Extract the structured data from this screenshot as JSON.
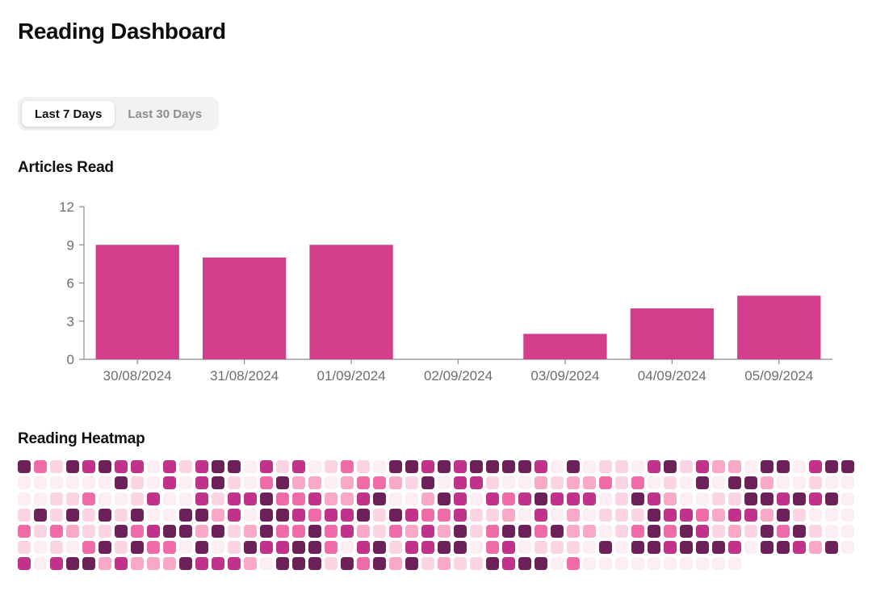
{
  "header": {
    "title": "Reading Dashboard"
  },
  "range_selector": {
    "name": "time-range-segmented-control",
    "options": [
      {
        "label": "Last 7 Days",
        "active": true
      },
      {
        "label": "Last 30 Days",
        "active": false
      }
    ]
  },
  "sections": {
    "articles_read_title": "Articles Read",
    "heatmap_title": "Reading Heatmap"
  },
  "colors": {
    "bar": "#d43d8c",
    "axis": "#8a8a8a",
    "tick_text": "#6d6d72",
    "title": "#0d0d0d",
    "segment_track": "#f2f2f2",
    "segment_active_bg": "#ffffff",
    "segment_inactive_text": "#8e8e93",
    "heat_level_0": "#fdeef4",
    "heat_level_1": "#fbd5e4",
    "heat_level_2": "#f9a8c8",
    "heat_level_3": "#f06ca8",
    "heat_level_4": "#c0318a",
    "heat_level_5": "#6b2057"
  },
  "chart_data": {
    "type": "bar",
    "title": "Articles Read",
    "xlabel": "",
    "ylabel": "",
    "categories": [
      "30/08/2024",
      "31/08/2024",
      "01/09/2024",
      "02/09/2024",
      "03/09/2024",
      "04/09/2024",
      "05/09/2024"
    ],
    "values": [
      9,
      8,
      9,
      0,
      2,
      4,
      5
    ],
    "ylim": [
      0,
      12
    ],
    "yticks": [
      0,
      3,
      6,
      9,
      12
    ],
    "ytick_labels": [
      "0",
      "3",
      "6",
      "9",
      "12"
    ],
    "grid": false,
    "legend": false,
    "bar_color": "#d43d8c"
  },
  "heatmap_data": {
    "type": "heatmap",
    "title": "Reading Heatmap",
    "rows": 7,
    "columns": 52,
    "levels": 6,
    "palette": [
      "#fdeef4",
      "#fbd5e4",
      "#f9a8c8",
      "#f06ca8",
      "#c0318a",
      "#6b2057"
    ],
    "matrix": [
      [
        5,
        3,
        1,
        5,
        4,
        5,
        4,
        4,
        0,
        4,
        1,
        4,
        5,
        5,
        0,
        4,
        1,
        4,
        0,
        1,
        3,
        1,
        0,
        5,
        5,
        4,
        5,
        4,
        5,
        5,
        5,
        5,
        4,
        0,
        5,
        0,
        1,
        1,
        0,
        4,
        5,
        1,
        4,
        2,
        2,
        0,
        5,
        5,
        0,
        4,
        5,
        5
      ],
      [
        0,
        0,
        0,
        0,
        0,
        0,
        5,
        1,
        0,
        4,
        0,
        4,
        5,
        1,
        0,
        3,
        5,
        2,
        2,
        0,
        2,
        3,
        3,
        2,
        1,
        5,
        0,
        4,
        4,
        1,
        0,
        0,
        2,
        1,
        2,
        2,
        3,
        1,
        3,
        0,
        1,
        0,
        5,
        0,
        5,
        5,
        2,
        0,
        0,
        1,
        0,
        0
      ],
      [
        0,
        0,
        1,
        1,
        3,
        0,
        0,
        1,
        4,
        0,
        0,
        4,
        1,
        4,
        4,
        5,
        3,
        3,
        4,
        2,
        2,
        4,
        5,
        0,
        0,
        2,
        5,
        4,
        0,
        4,
        3,
        4,
        5,
        4,
        4,
        4,
        0,
        1,
        5,
        4,
        2,
        0,
        0,
        1,
        1,
        5,
        5,
        4,
        5,
        4,
        5,
        0
      ],
      [
        1,
        5,
        1,
        5,
        1,
        5,
        1,
        5,
        0,
        0,
        5,
        5,
        2,
        4,
        0,
        5,
        5,
        4,
        3,
        4,
        4,
        5,
        1,
        5,
        4,
        3,
        3,
        4,
        1,
        1,
        2,
        0,
        4,
        0,
        2,
        0,
        1,
        1,
        1,
        5,
        4,
        4,
        3,
        2,
        4,
        4,
        2,
        5,
        1,
        0,
        0,
        0
      ],
      [
        3,
        1,
        3,
        2,
        1,
        1,
        5,
        3,
        4,
        5,
        5,
        2,
        5,
        1,
        2,
        5,
        3,
        3,
        5,
        3,
        4,
        2,
        1,
        3,
        2,
        4,
        2,
        5,
        1,
        3,
        5,
        5,
        3,
        5,
        2,
        2,
        0,
        1,
        3,
        5,
        3,
        5,
        4,
        1,
        2,
        1,
        5,
        3,
        5,
        1,
        0,
        0
      ],
      [
        1,
        0,
        1,
        0,
        3,
        5,
        1,
        5,
        3,
        3,
        0,
        5,
        0,
        1,
        5,
        4,
        4,
        5,
        5,
        3,
        0,
        4,
        5,
        1,
        4,
        4,
        5,
        5,
        0,
        3,
        4,
        0,
        1,
        1,
        1,
        0,
        5,
        0,
        5,
        5,
        4,
        5,
        5,
        5,
        4,
        0,
        5,
        5,
        4,
        2,
        5,
        0
      ],
      [
        4,
        0,
        4,
        5,
        5,
        2,
        4,
        2,
        2,
        2,
        5,
        4,
        4,
        4,
        2,
        0,
        5,
        5,
        5,
        1,
        5,
        3,
        5,
        2,
        5,
        1,
        2,
        1,
        1,
        5,
        4,
        5,
        5,
        0,
        3,
        0,
        0,
        0,
        0,
        0,
        0,
        0,
        0,
        0,
        0,
        0,
        0,
        0,
        0,
        0,
        0,
        0
      ]
    ],
    "last_row_visible_columns": 45
  }
}
